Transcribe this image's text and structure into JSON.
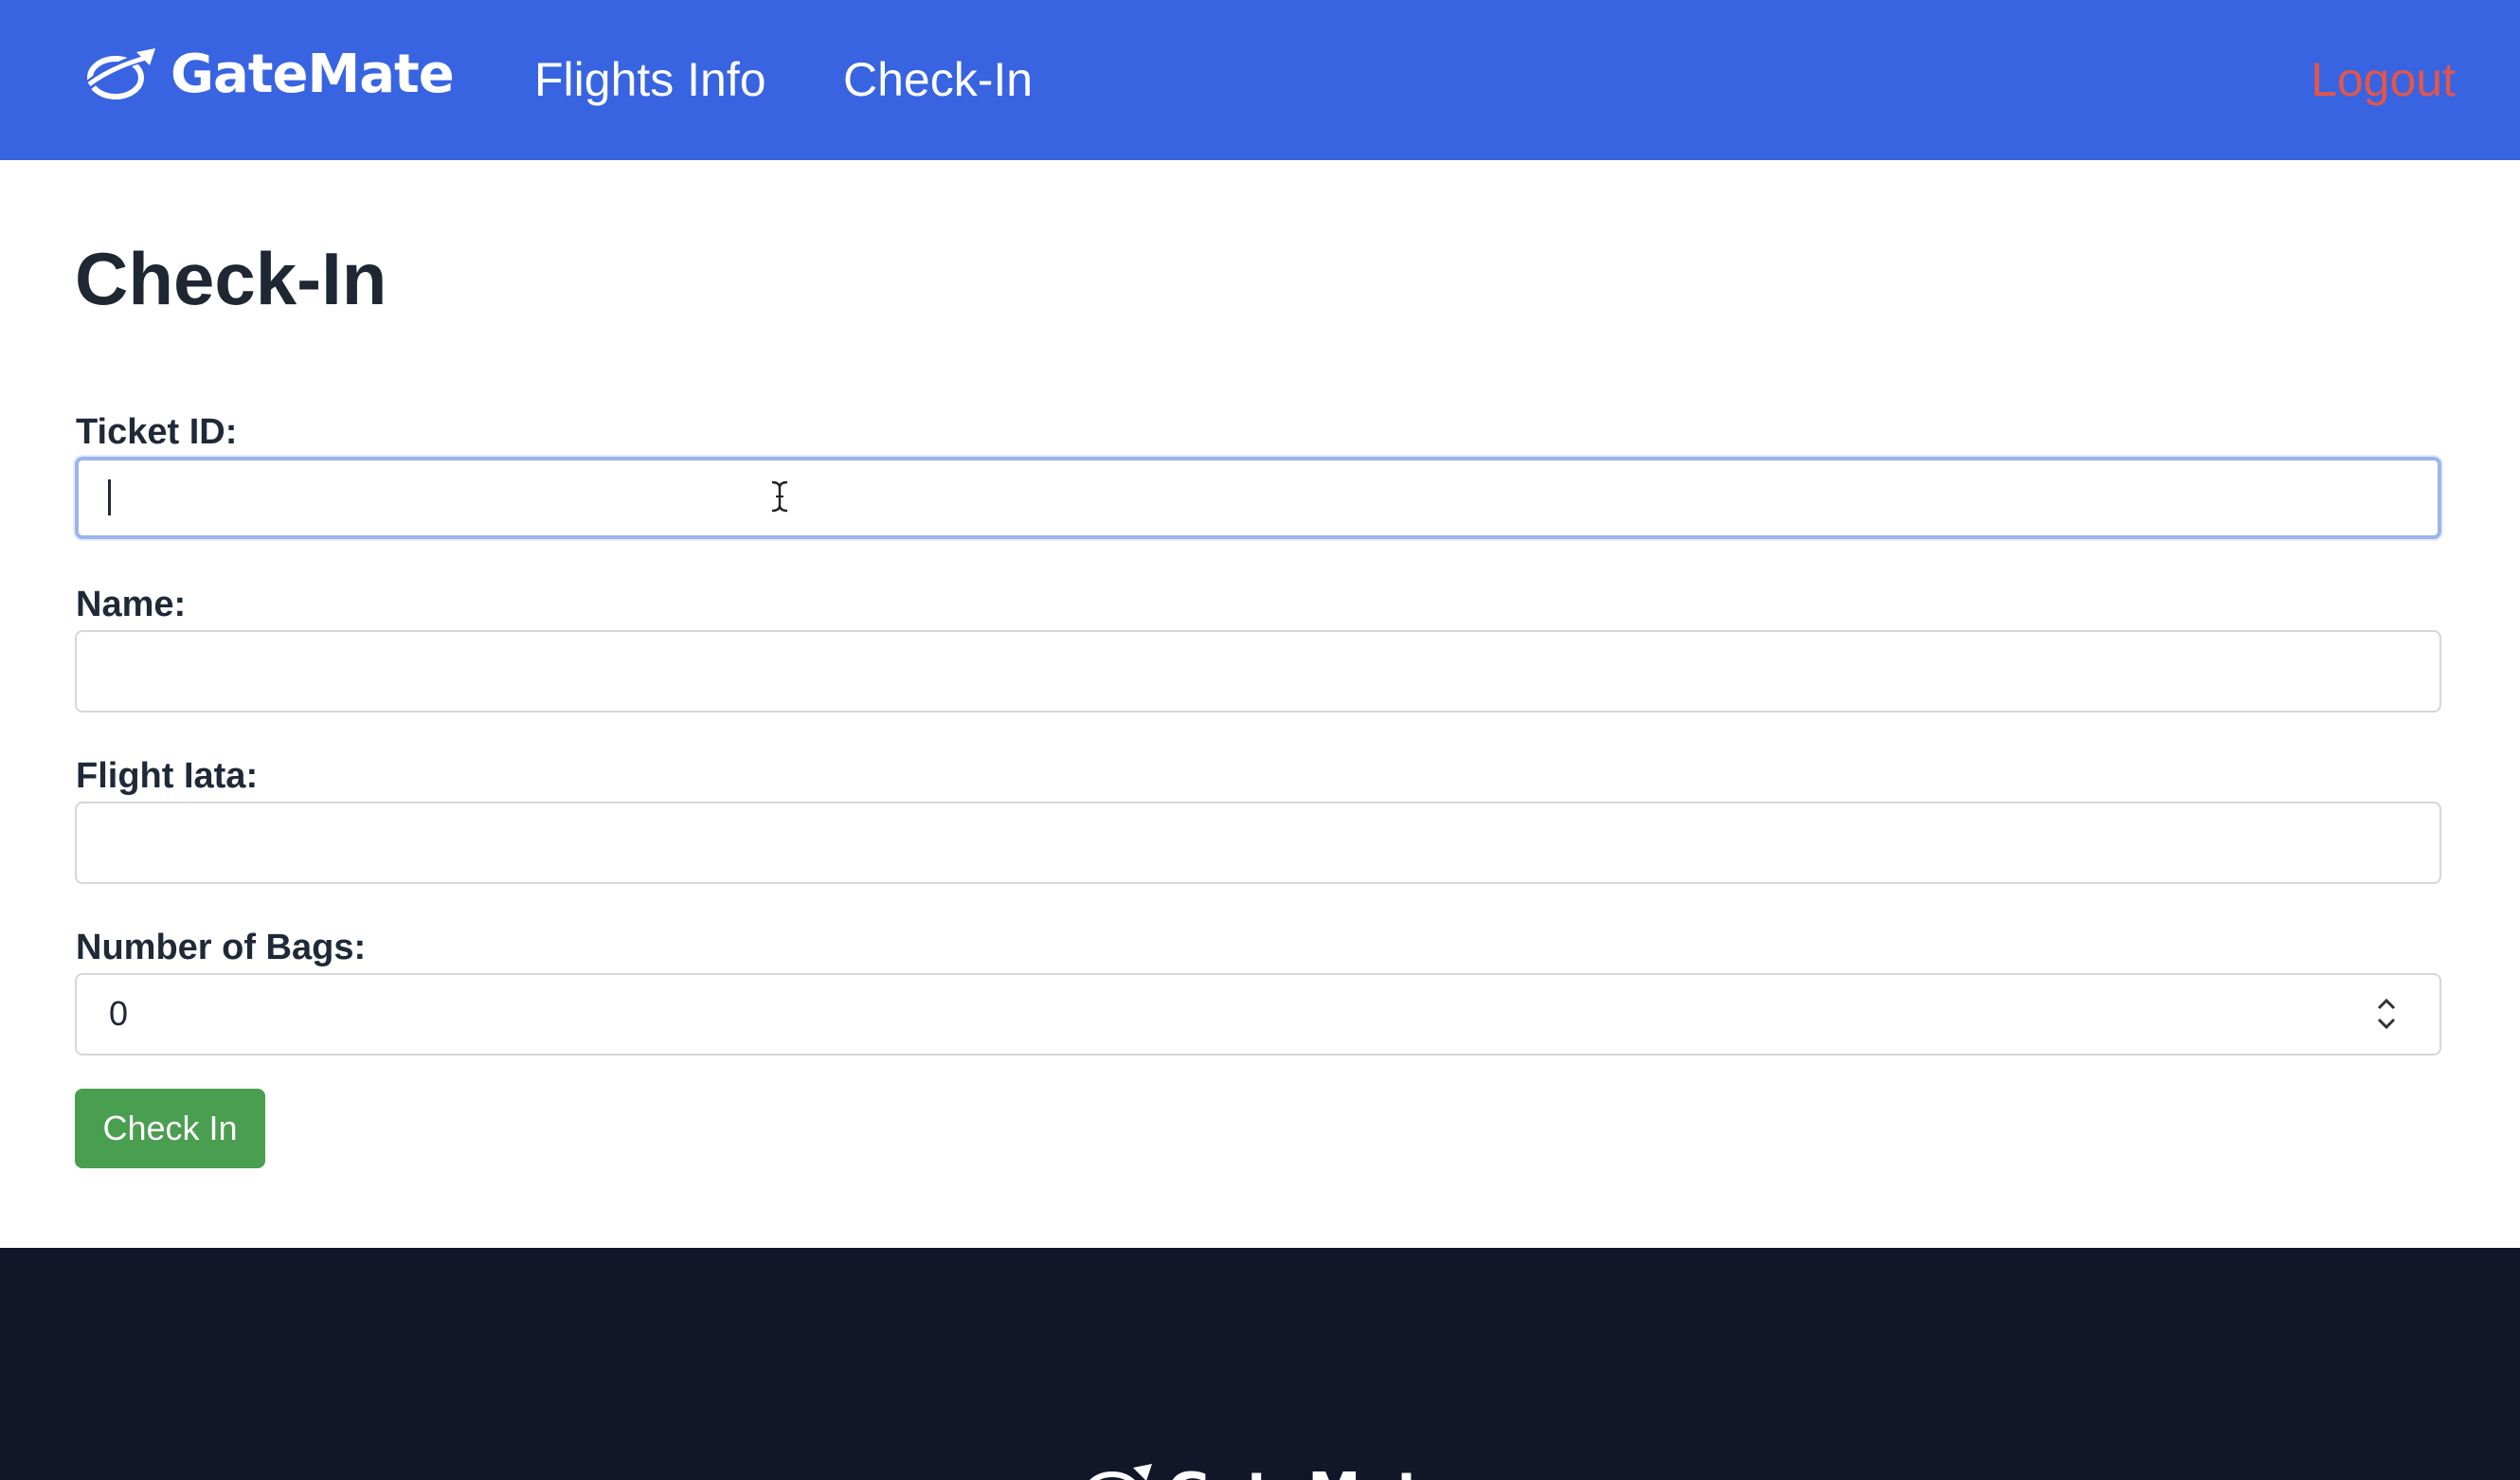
{
  "brand": {
    "name": "GateMate",
    "logo_icon": "plane-orbit-icon"
  },
  "nav": {
    "flights_info": "Flights Info",
    "check_in": "Check-In",
    "logout": "Logout"
  },
  "page": {
    "title": "Check-In"
  },
  "form": {
    "ticket_id": {
      "label": "Ticket ID:",
      "value": ""
    },
    "name": {
      "label": "Name:",
      "value": ""
    },
    "flight_iata": {
      "label": "Flight Iata:",
      "value": ""
    },
    "bags": {
      "label": "Number of Bags:",
      "value": "0"
    },
    "submit_label": "Check In"
  },
  "footer": {
    "brand_name": "GateMate"
  },
  "colors": {
    "header_bg": "#3864e2",
    "logout": "#e2564b",
    "submit_bg": "#4a9e50",
    "footer_bg": "#111729",
    "focus_ring": "#9bb4ec"
  }
}
